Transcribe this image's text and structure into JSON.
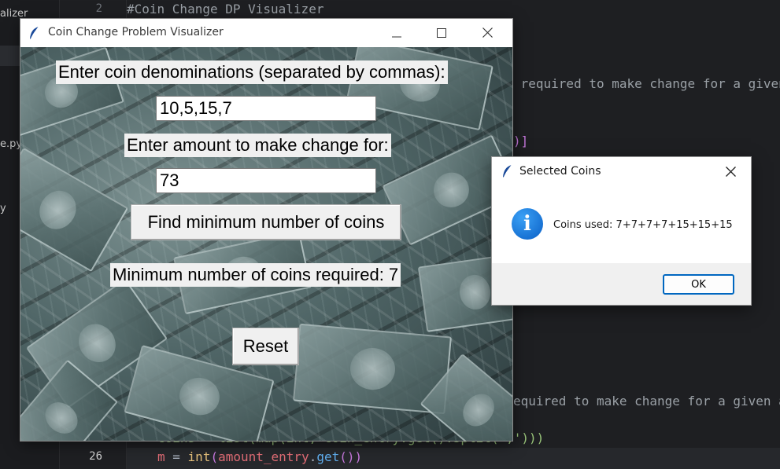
{
  "editor": {
    "sidebar_items": [
      "alizer",
      "e.py",
      "y"
    ],
    "line_numbers": [
      "2",
      "26"
    ],
    "code_lines": {
      "comment_title": "#Coin Change DP Visualizer",
      "doc_fragment_1": " required to make change for a given",
      "bracket_fragment": ")]",
      "doc_fragment_2": "equired to make change for a given a",
      "coins_line": "coins = list(map(int, coin_entry.get().split(',')))",
      "m_line": {
        "var": "m",
        "eq": " = ",
        "fn": "int",
        "open": "(",
        "obj": "amount_entry",
        "dot": ".",
        "call": "get",
        "close": "())"
      }
    }
  },
  "main_window": {
    "title": "Coin Change Problem Visualizer",
    "coin_label": "Enter coin denominations (separated by commas):",
    "coin_entry_value": "10,5,15,7",
    "amount_label": "Enter amount to make change for:",
    "amount_entry_value": "73",
    "find_button_label": "Find minimum number of coins",
    "result_label": "Minimum number of coins required: 7",
    "reset_button_label": "Reset"
  },
  "dialog": {
    "title": "Selected Coins",
    "message": "Coins used: 7+7+7+7+15+15+15",
    "ok_label": "OK",
    "info_glyph": "i"
  },
  "icons": {
    "app": "feather-icon",
    "minimize": "minimize-icon",
    "maximize": "maximize-icon",
    "close": "close-icon",
    "info": "info-icon"
  },
  "colors": {
    "editor_bg": "#1e1f22",
    "dialog_ok_border": "#0067c0",
    "info_blue": "#0a5fc6"
  }
}
